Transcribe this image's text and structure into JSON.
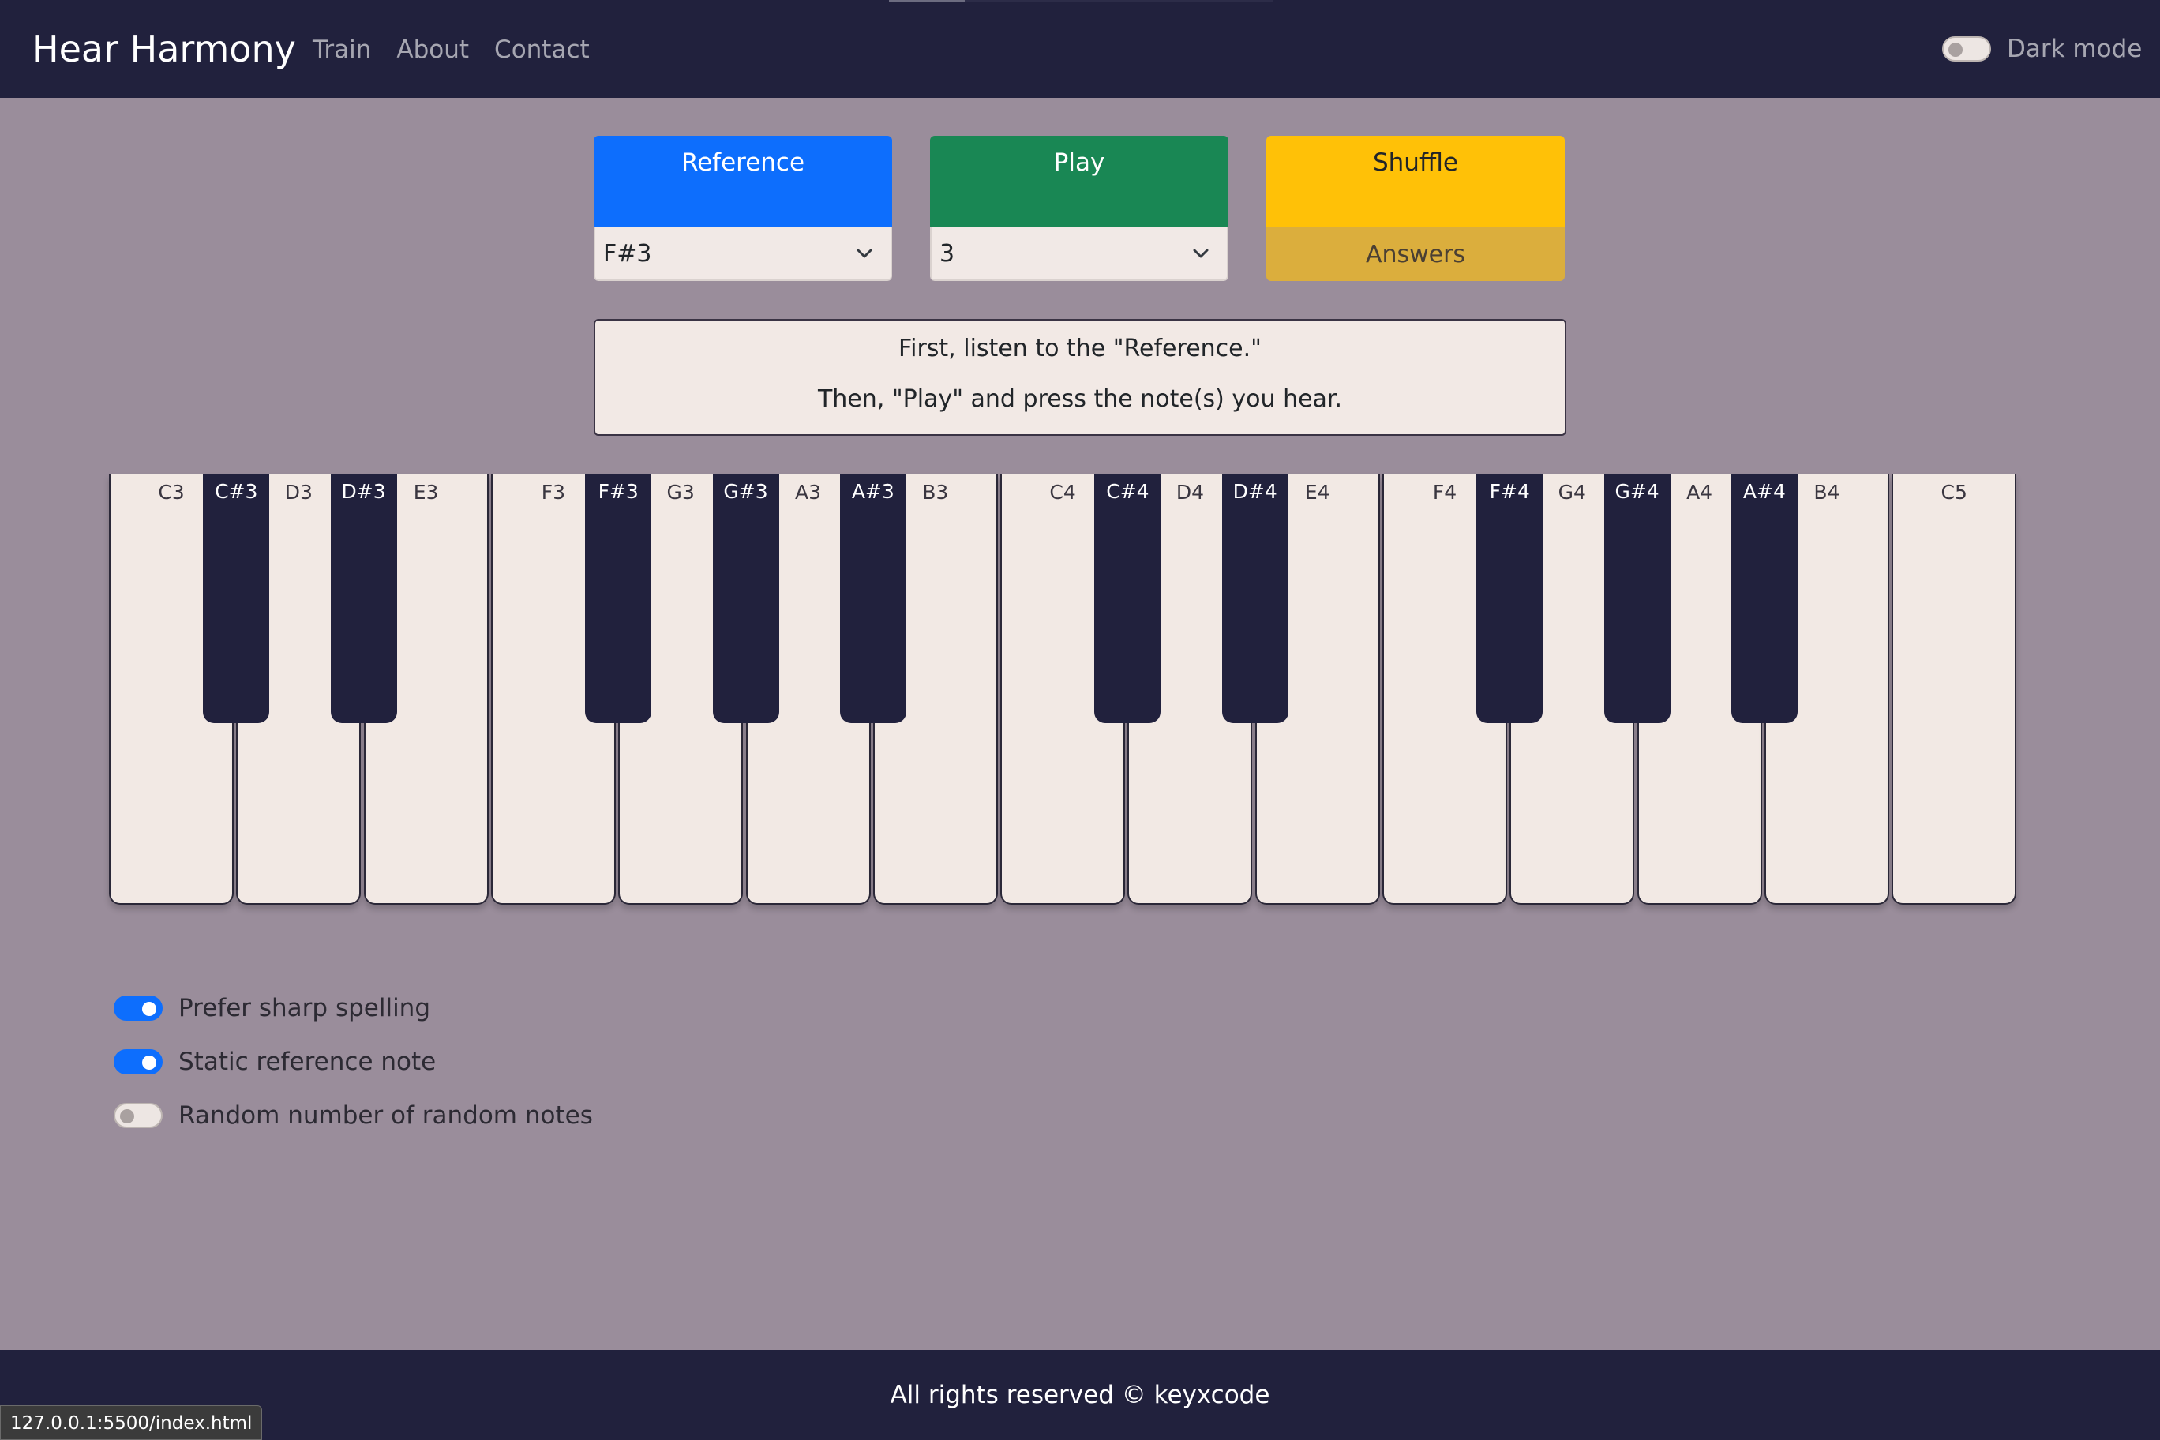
{
  "navbar": {
    "brand": "Hear Harmony",
    "links": [
      "Train",
      "About",
      "Contact"
    ],
    "dark_mode_label": "Dark mode",
    "dark_mode_on": false
  },
  "controls": {
    "reference": {
      "label": "Reference",
      "selected": "F#3"
    },
    "play": {
      "label": "Play",
      "selected": "3"
    },
    "shuffle": {
      "label": "Shuffle",
      "answers_label": "Answers"
    }
  },
  "instructions": {
    "line1": "First, listen to the \"Reference.\"",
    "line2": "Then, \"Play\" and press the note(s) you hear."
  },
  "piano": {
    "white_keys": [
      "C3",
      "D3",
      "E3",
      "F3",
      "G3",
      "A3",
      "B3",
      "C4",
      "D4",
      "E4",
      "F4",
      "G4",
      "A4",
      "B4",
      "C5"
    ],
    "black_keys": [
      "C#3",
      "D#3",
      "F#3",
      "G#3",
      "A#3",
      "C#4",
      "D#4",
      "F#4",
      "G#4",
      "A#4"
    ]
  },
  "options": [
    {
      "label": "Prefer sharp spelling",
      "on": true
    },
    {
      "label": "Static reference note",
      "on": true
    },
    {
      "label": "Random number of random notes",
      "on": false
    }
  ],
  "footer": {
    "text": "All rights reserved © keyxcode"
  },
  "status_bar": {
    "url": "127.0.0.1:5500/index.html"
  },
  "colors": {
    "navbar": "#21213d",
    "background": "#9a8d9b",
    "reference": "#0d6efd",
    "play": "#198754",
    "shuffle": "#ffc107",
    "answers": "#dbae3d"
  }
}
